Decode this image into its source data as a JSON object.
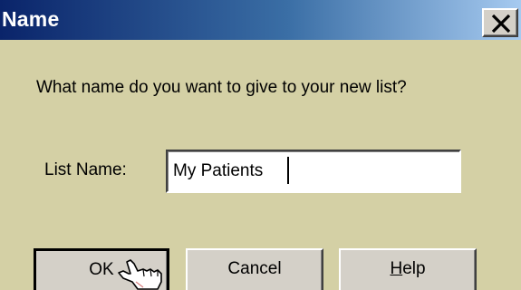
{
  "dialog": {
    "title": "Name",
    "prompt": "What name do you want to give to your new list?",
    "list_label": "List Name:",
    "list_value": "My Patients"
  },
  "buttons": {
    "ok": "OK",
    "cancel": "Cancel",
    "help_mnemonic": "H",
    "help_rest": "elp"
  },
  "colors": {
    "dialog_bg": "#d4d0a5",
    "title_gradient_start": "#0a246a",
    "title_gradient_end": "#a6caf0"
  },
  "icons": [
    "close-icon",
    "hand-pointer-cursor-icon"
  ]
}
